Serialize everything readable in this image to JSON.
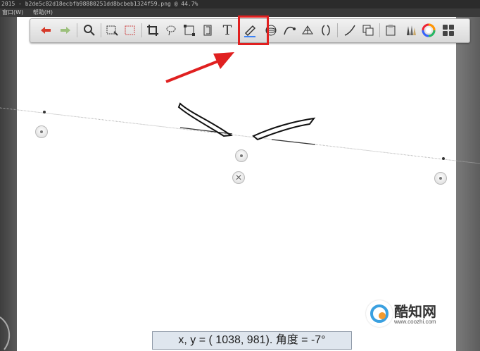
{
  "window": {
    "title": "2015 - b2de5c82d18ecbfb98880251dd8bcbeb1324f59.png @ 44.7%"
  },
  "menu": {
    "items": [
      "窗口(W)",
      "帮助(H)"
    ]
  },
  "toolbar": {
    "tools": [
      {
        "name": "undo-icon"
      },
      {
        "name": "redo-icon"
      },
      {
        "name": "magnify-icon"
      },
      {
        "name": "selection-rect-icon"
      },
      {
        "name": "selection-rect-red-icon"
      },
      {
        "name": "crop-icon"
      },
      {
        "name": "lasso-icon"
      },
      {
        "name": "transform-icon"
      },
      {
        "name": "layer-icon"
      },
      {
        "name": "text-icon",
        "glyph": "T"
      },
      {
        "name": "ruler-icon",
        "selected": true
      },
      {
        "name": "ellipse-guide-icon"
      },
      {
        "name": "curve-icon"
      },
      {
        "name": "perspective-grid-icon"
      },
      {
        "name": "symmetry-icon"
      },
      {
        "name": "stroke-icon"
      },
      {
        "name": "copy-icon"
      },
      {
        "name": "paste-icon"
      },
      {
        "name": "brushes-icon"
      },
      {
        "name": "color-wheel-icon"
      },
      {
        "name": "layers-grid-icon"
      }
    ],
    "accent": "#e02020"
  },
  "status": {
    "text": "x, y = ( 1038,   981). 角度 = -7°"
  },
  "watermark": {
    "name": "酷知网",
    "url": "www.coozhi.com"
  }
}
